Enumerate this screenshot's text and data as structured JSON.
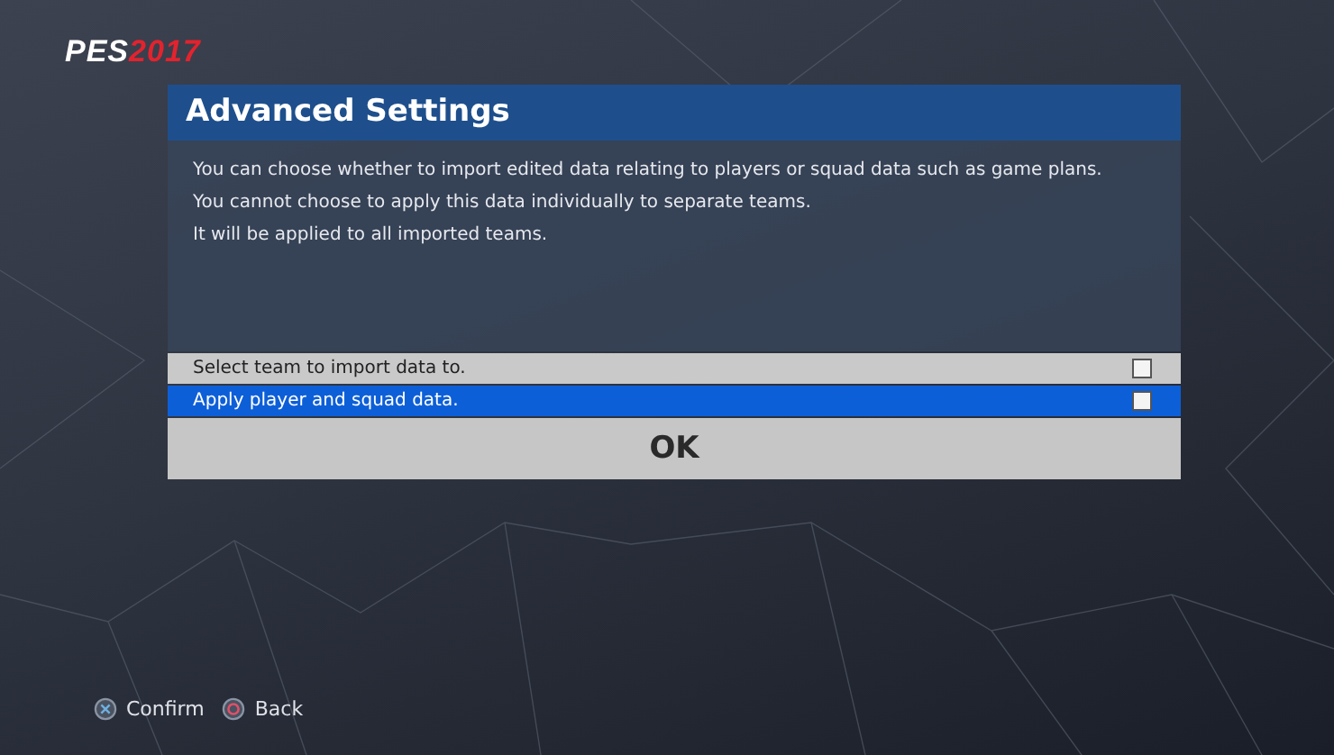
{
  "logo": {
    "brand": "PES",
    "year": "2017"
  },
  "dialog": {
    "title": "Advanced Settings",
    "lines": [
      "You can choose whether to import edited data relating to players or squad data such as game plans.",
      "You cannot choose to apply this data individually to separate teams.",
      "It will be applied to all imported teams."
    ],
    "options": [
      {
        "label": "Select team to import data to.",
        "selected": false,
        "checked": false
      },
      {
        "label": "Apply player and squad data.",
        "selected": true,
        "checked": false
      }
    ],
    "ok": "OK"
  },
  "hints": [
    {
      "kind": "cross",
      "label": "Confirm"
    },
    {
      "kind": "circle",
      "label": "Back"
    }
  ]
}
